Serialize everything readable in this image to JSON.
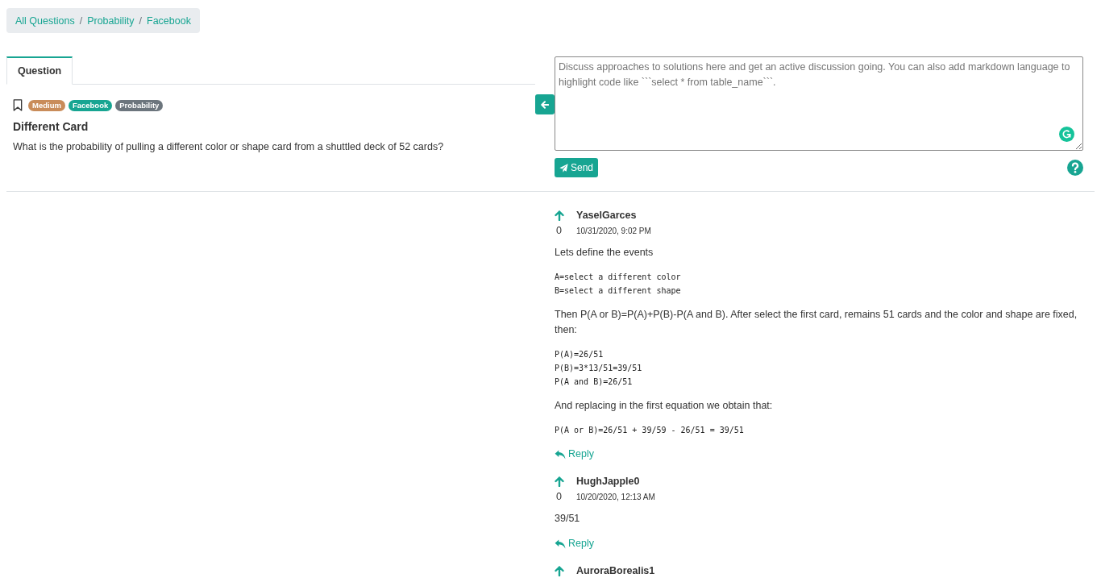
{
  "breadcrumb": {
    "separator": "/",
    "items": [
      {
        "label": "All Questions"
      },
      {
        "label": "Probability"
      },
      {
        "label": "Facebook"
      }
    ]
  },
  "tabs": [
    {
      "label": "Question",
      "selected": true
    }
  ],
  "question": {
    "bookmarked": false,
    "tags": [
      {
        "label": "Medium",
        "color": "#c98c5a"
      },
      {
        "label": "Facebook",
        "color": "#17a592"
      },
      {
        "label": "Probability",
        "color": "#6c757d"
      }
    ],
    "title": "Different Card",
    "text": "What is the probability of pulling a different color or shape card from a shuttled deck of 52 cards?"
  },
  "discussion": {
    "placeholder": "Discuss approaches to solutions here and get an active discussion going. You can also add markdown language to highlight code like ```select * from table_name```.",
    "send_label": "Send"
  },
  "comments": [
    {
      "author": "YaselGarces",
      "votes": "0",
      "date": "10/31/2020, 9:02 PM",
      "body": [
        {
          "kind": "text",
          "text": "Lets define the events"
        },
        {
          "kind": "code",
          "text": "A=select a different color\nB=select a different shape"
        },
        {
          "kind": "text",
          "text": "Then P(A or B)=P(A)+P(B)-P(A and B). After select the first card, remains 51 cards and the color and shape are fixed, then:"
        },
        {
          "kind": "code",
          "text": "P(A)=26/51\nP(B)=3*13/51=39/51\nP(A and B)=26/51"
        },
        {
          "kind": "text",
          "text": "And replacing in the first equation we obtain that:"
        },
        {
          "kind": "code",
          "text": "P(A or B)=26/51 + 39/59 - 26/51 = 39/51"
        }
      ],
      "reply_label": "Reply"
    },
    {
      "author": "HughJapple0",
      "votes": "0",
      "date": "10/20/2020, 12:13 AM",
      "body": [
        {
          "kind": "text",
          "text": "39/51"
        }
      ],
      "reply_label": "Reply"
    },
    {
      "author": "AuroraBorealis1"
    }
  ]
}
